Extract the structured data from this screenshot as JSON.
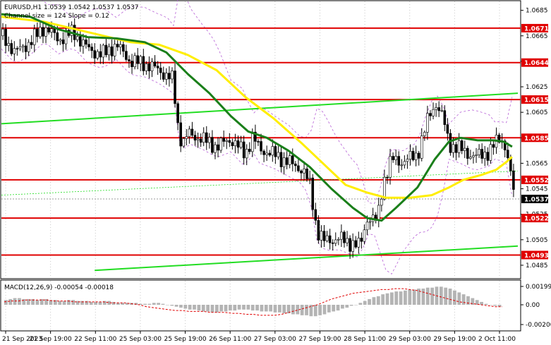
{
  "header": {
    "symbol_line": "EURUSD,H1  1.0539 1.0542 1.0537 1.0537",
    "channel_line": "Channel size = 124 Slope = 0.12"
  },
  "macd": {
    "label": "MACD(12,26,9) -0.00054 -0.00018",
    "ticks": [
      "0.00199",
      "0.00",
      "-0.00200"
    ]
  },
  "colors": {
    "level_line": "#e00000",
    "ma_fast": "#1a7f1a",
    "ma_slow": "#ffee00",
    "channel": "#22dd22",
    "bollinger": "#b65fd6",
    "candle": "#000000",
    "macd_hist": "#b4b4b4",
    "macd_signal": "#e00000",
    "current_price_bg": "#000000"
  },
  "chart_data": {
    "type": "candlestick",
    "symbol": "EURUSD",
    "timeframe": "H1",
    "ylim": [
      1.0475,
      1.0692
    ],
    "y_ticks": [
      "1.0685",
      "1.0665",
      "1.0645",
      "1.0625",
      "1.0605",
      "1.0585",
      "1.0565",
      "1.0545",
      "1.0525",
      "1.0505",
      "1.0485"
    ],
    "x_ticks": [
      "21 Sep 2023",
      "21 Sep 19:00",
      "22 Sep 11:00",
      "25 Sep 03:00",
      "25 Sep 19:00",
      "26 Sep 11:00",
      "27 Sep 03:00",
      "27 Sep 19:00",
      "28 Sep 11:00",
      "29 Sep 03:00",
      "29 Sep 19:00",
      "2 Oct 11:00"
    ],
    "levels": [
      {
        "value": 1.0671,
        "label": "1.0671"
      },
      {
        "value": 1.0644,
        "label": "1.0644"
      },
      {
        "value": 1.0615,
        "label": "1.0615"
      },
      {
        "value": 1.0585,
        "label": "1.0585"
      },
      {
        "value": 1.0552,
        "label": "1.0552"
      },
      {
        "value": 1.0522,
        "label": "1.0522"
      },
      {
        "value": 1.0493,
        "label": "1.0493"
      }
    ],
    "current_price": {
      "value": 1.0537,
      "label": "1.0537"
    },
    "price_path": [
      [
        0,
        1.0665
      ],
      [
        10,
        1.0652
      ],
      [
        20,
        1.066
      ],
      [
        30,
        1.0672
      ],
      [
        40,
        1.0662
      ],
      [
        50,
        1.0668
      ],
      [
        60,
        1.0655
      ],
      [
        70,
        1.065
      ],
      [
        80,
        1.0658
      ],
      [
        90,
        1.0645
      ],
      [
        100,
        1.0643
      ],
      [
        110,
        1.0638
      ],
      [
        120,
        1.063
      ],
      [
        122,
        1.06
      ],
      [
        126,
        1.058
      ],
      [
        130,
        1.0588
      ],
      [
        140,
        1.0584
      ],
      [
        150,
        1.0578
      ],
      [
        160,
        1.0584
      ],
      [
        170,
        1.0572
      ],
      [
        175,
        1.0586
      ],
      [
        180,
        1.0576
      ],
      [
        190,
        1.0572
      ],
      [
        200,
        1.0566
      ],
      [
        210,
        1.056
      ],
      [
        215,
        1.0548
      ],
      [
        220,
        1.0512
      ],
      [
        225,
        1.0504
      ],
      [
        235,
        1.0506
      ],
      [
        245,
        1.0502
      ],
      [
        250,
        1.05
      ],
      [
        255,
        1.0522
      ],
      [
        262,
        1.052
      ],
      [
        266,
        1.055
      ],
      [
        272,
        1.0568
      ],
      [
        280,
        1.0566
      ],
      [
        290,
        1.0572
      ],
      [
        298,
        1.0602
      ],
      [
        303,
        1.0612
      ],
      [
        308,
        1.06
      ],
      [
        312,
        1.058
      ],
      [
        320,
        1.0576
      ],
      [
        330,
        1.057
      ],
      [
        340,
        1.0574
      ],
      [
        348,
        1.0586
      ],
      [
        352,
        1.0576
      ],
      [
        356,
        1.0548
      ],
      [
        359,
        1.0537
      ]
    ],
    "ma_fast_path": [
      [
        0,
        1.0682
      ],
      [
        20,
        1.068
      ],
      [
        40,
        1.067
      ],
      [
        60,
        1.0664
      ],
      [
        80,
        1.0663
      ],
      [
        100,
        1.066
      ],
      [
        115,
        1.0652
      ],
      [
        130,
        1.0635
      ],
      [
        145,
        1.062
      ],
      [
        160,
        1.0602
      ],
      [
        172,
        1.059
      ],
      [
        185,
        1.0585
      ],
      [
        200,
        1.0575
      ],
      [
        215,
        1.0562
      ],
      [
        230,
        1.0545
      ],
      [
        245,
        1.053
      ],
      [
        255,
        1.0522
      ],
      [
        265,
        1.052
      ],
      [
        275,
        1.053
      ],
      [
        290,
        1.0546
      ],
      [
        302,
        1.0568
      ],
      [
        312,
        1.0582
      ],
      [
        320,
        1.0585
      ],
      [
        332,
        1.0583
      ],
      [
        343,
        1.0583
      ],
      [
        350,
        1.0582
      ],
      [
        356,
        1.0578
      ]
    ],
    "ma_slow_path": [
      [
        0,
        1.068
      ],
      [
        30,
        1.0676
      ],
      [
        60,
        1.0668
      ],
      [
        90,
        1.066
      ],
      [
        110,
        1.0658
      ],
      [
        130,
        1.065
      ],
      [
        150,
        1.0638
      ],
      [
        170,
        1.0617
      ],
      [
        190,
        1.06
      ],
      [
        210,
        1.058
      ],
      [
        225,
        1.0564
      ],
      [
        240,
        1.0548
      ],
      [
        255,
        1.0542
      ],
      [
        268,
        1.0538
      ],
      [
        285,
        1.0538
      ],
      [
        300,
        1.054
      ],
      [
        312,
        1.0546
      ],
      [
        322,
        1.0552
      ],
      [
        335,
        1.0556
      ],
      [
        345,
        1.056
      ],
      [
        352,
        1.0566
      ],
      [
        356,
        1.057
      ]
    ],
    "channel_upper": [
      [
        0,
        1.0596
      ],
      [
        360,
        1.062
      ]
    ],
    "channel_mid": [
      [
        0,
        1.054
      ],
      [
        360,
        1.0559
      ]
    ],
    "channel_lower": [
      [
        65,
        1.0481
      ],
      [
        360,
        1.05
      ]
    ],
    "macd_hist": [
      5,
      6,
      7,
      7,
      6,
      6,
      6,
      5,
      6,
      6,
      5,
      5,
      4,
      4,
      5,
      5,
      4,
      4,
      4,
      3,
      3,
      3,
      4,
      4,
      3,
      2,
      2,
      2,
      2,
      2,
      1,
      1,
      1,
      2,
      2,
      1,
      0,
      -1,
      -2,
      -3,
      -4,
      -5,
      -5,
      -6,
      -7,
      -7,
      -8,
      -8,
      -7,
      -7,
      -6,
      -6,
      -5,
      -5,
      -5,
      -6,
      -6,
      -7,
      -7,
      -7,
      -8,
      -8,
      -9,
      -9,
      -10,
      -10,
      -11,
      -11,
      -12,
      -12,
      -11,
      -10,
      -8,
      -7,
      -6,
      -4,
      -3,
      -1,
      0,
      2,
      4,
      6,
      8,
      9,
      11,
      12,
      13,
      14,
      14,
      15,
      16,
      16,
      17,
      17,
      18,
      18,
      19,
      19,
      18,
      17,
      15,
      13,
      11,
      9,
      7,
      5,
      3,
      1,
      0,
      -1,
      -2
    ],
    "macd_signal": [
      3,
      4,
      4,
      5,
      5,
      5,
      5,
      4,
      4,
      4,
      3,
      3,
      3,
      3,
      3,
      2,
      2,
      2,
      1,
      0,
      -2,
      -3,
      -4,
      -5,
      -6,
      -6,
      -7,
      -7,
      -7,
      -8,
      -8,
      -8,
      -9,
      -9,
      -10,
      -10,
      -11,
      -11,
      -11,
      -10,
      -8,
      -6,
      -4,
      -2,
      0,
      3,
      6,
      8,
      10,
      12,
      13,
      14,
      15,
      16,
      16,
      17,
      17,
      16,
      15,
      13,
      11,
      9,
      7,
      5,
      3,
      2,
      1,
      0,
      -1,
      -2,
      -2
    ]
  }
}
